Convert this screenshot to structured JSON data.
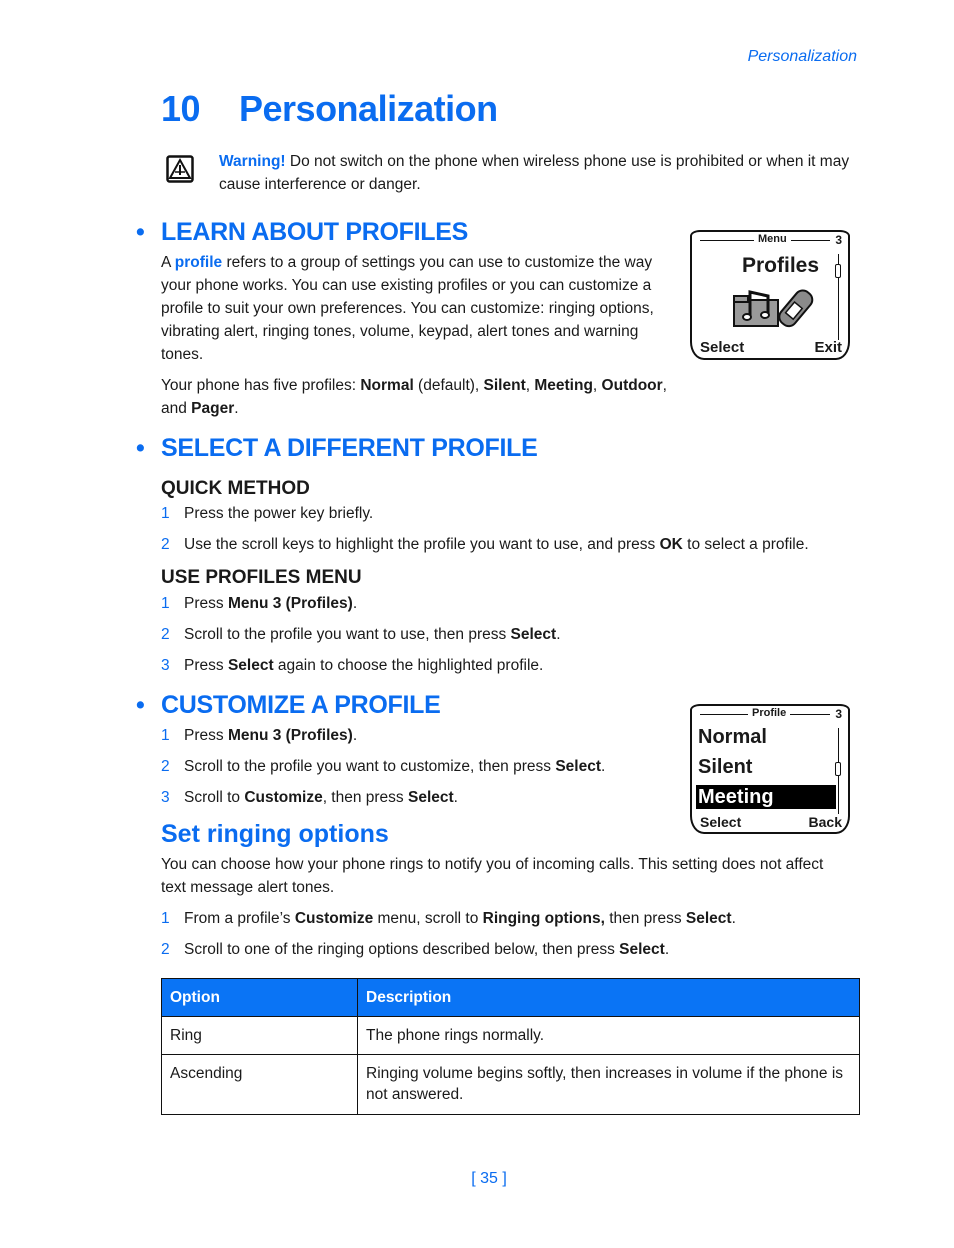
{
  "running_head": "Personalization",
  "chapter": {
    "number": "10",
    "title": "Personalization"
  },
  "warning": {
    "icon": "warning-triangle-icon",
    "label": "Warning!",
    "text": " Do not switch on the phone when wireless phone use is prohibited or when it may cause interference or danger."
  },
  "learn": {
    "heading": "LEARN ABOUT PROFILES",
    "para1_pre": "A ",
    "para1_term": "profile",
    "para1_post": " refers to a group of settings you can use to customize the way your phone works. You can use existing profiles or you can customize a profile to suit your own preferences. You can customize: ringing options, vibrating alert, ringing tones, volume, keypad, alert tones and warning tones.",
    "para2": {
      "t0": "Your phone has five profiles: ",
      "p1": "Normal",
      "t1": " (default), ",
      "p2": "Silent",
      "t2": ", ",
      "p3": "Meeting",
      "t3": ", ",
      "p4": "Outdoor",
      "t4": ", and ",
      "p5": "Pager",
      "t5": "."
    },
    "screen": {
      "header": "Menu",
      "index": "3",
      "title": "Profiles",
      "icon": "profiles-music-phone-icon",
      "left_soft": "Select",
      "right_soft": "Exit"
    }
  },
  "select": {
    "heading": "SELECT A DIFFERENT PROFILE",
    "quick": {
      "heading": "QUICK METHOD",
      "steps": [
        {
          "n": "1",
          "parts": [
            "Press the power key briefly."
          ]
        },
        {
          "n": "2",
          "t0": "Use the scroll keys to highlight the profile you want to use, and press ",
          "b0": "OK",
          "t1": " to select a profile."
        }
      ]
    },
    "menu": {
      "heading": "USE PROFILES MENU",
      "s1": {
        "n": "1",
        "t0": "Press ",
        "b0": "Menu 3 (Profiles)",
        "t1": "."
      },
      "s2": {
        "n": "2",
        "t0": "Scroll to the profile you want to use, then press ",
        "b0": "Select",
        "t1": "."
      },
      "s3": {
        "n": "3",
        "t0": "Press ",
        "b0": "Select",
        "t1": " again to choose the highlighted profile."
      }
    }
  },
  "customize": {
    "heading": "CUSTOMIZE A PROFILE",
    "s1": {
      "n": "1",
      "t0": "Press ",
      "b0": "Menu 3 (Profiles)",
      "t1": "."
    },
    "s2": {
      "n": "2",
      "t0": "Scroll to the profile you want to customize, then press ",
      "b0": "Select",
      "t1": "."
    },
    "s3": {
      "n": "3",
      "t0": "Scroll to ",
      "b0": "Customize",
      "t1": ", then press ",
      "b1": "Select",
      "t2": "."
    },
    "screen": {
      "header": "Profile",
      "index": "3",
      "items": [
        "Normal",
        "Silent",
        "Meeting"
      ],
      "selected": "Meeting",
      "left_soft": "Select",
      "right_soft": "Back"
    }
  },
  "ringing": {
    "heading": "Set ringing options",
    "intro": "You can choose how your phone rings to notify you of incoming calls. This setting does not affect text message alert tones.",
    "s1": {
      "n": "1",
      "t0": "From a profile’s ",
      "b0": "Customize",
      "t1": " menu, scroll to ",
      "b1": "Ringing options,",
      "t2": " then press ",
      "b2": "Select",
      "t3": "."
    },
    "s2": {
      "n": "2",
      "t0": "Scroll to one of the ringing options described below, then press ",
      "b0": "Select",
      "t1": "."
    },
    "table": {
      "headers": [
        "Option",
        "Description"
      ],
      "rows": [
        [
          "Ring",
          "The phone rings normally."
        ],
        [
          "Ascending",
          "Ringing volume begins softly, then increases in volume if the phone is not answered."
        ]
      ]
    }
  },
  "page_number": "[ 35 ]",
  "colors": {
    "accent": "#0a6cf0",
    "table_header": "#0a74f5"
  }
}
